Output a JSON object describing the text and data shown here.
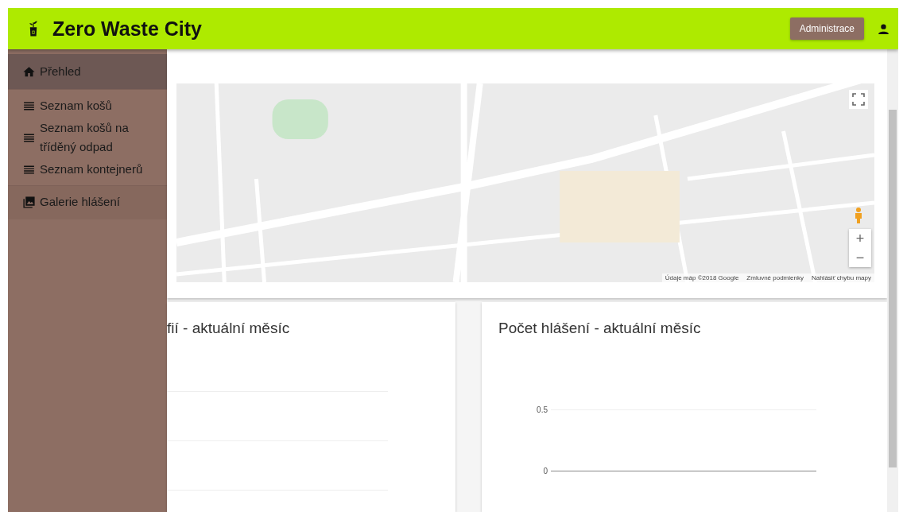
{
  "header": {
    "title": "Zero Waste City",
    "admin_button": "Administrace"
  },
  "sidebar": {
    "sections": [
      {
        "items": [
          {
            "kind": "home",
            "label": "Přehled",
            "selected": true
          }
        ]
      },
      {
        "items": [
          {
            "kind": "list",
            "label": "Seznam košů",
            "selected": false
          },
          {
            "kind": "list",
            "label": "Seznam košů na tříděný odpad",
            "selected": false
          },
          {
            "kind": "list",
            "label": "Seznam kontejnerů",
            "selected": false
          }
        ]
      },
      {
        "items": [
          {
            "kind": "gallery",
            "label": "Galerie hlášení",
            "selected": false
          }
        ]
      }
    ]
  },
  "map": {
    "zoom_in": "+",
    "zoom_out": "−",
    "attribution": [
      "Údaje máp ©2018 Google",
      "Zmluvné podmienky",
      "Nahlásiť chybu mapy"
    ]
  },
  "charts": [
    {
      "title": "fií - aktuální měsíc"
    },
    {
      "title": "Počet hlášení - aktuální měsíc",
      "y_ticks": [
        "0.5",
        "0"
      ]
    }
  ]
}
